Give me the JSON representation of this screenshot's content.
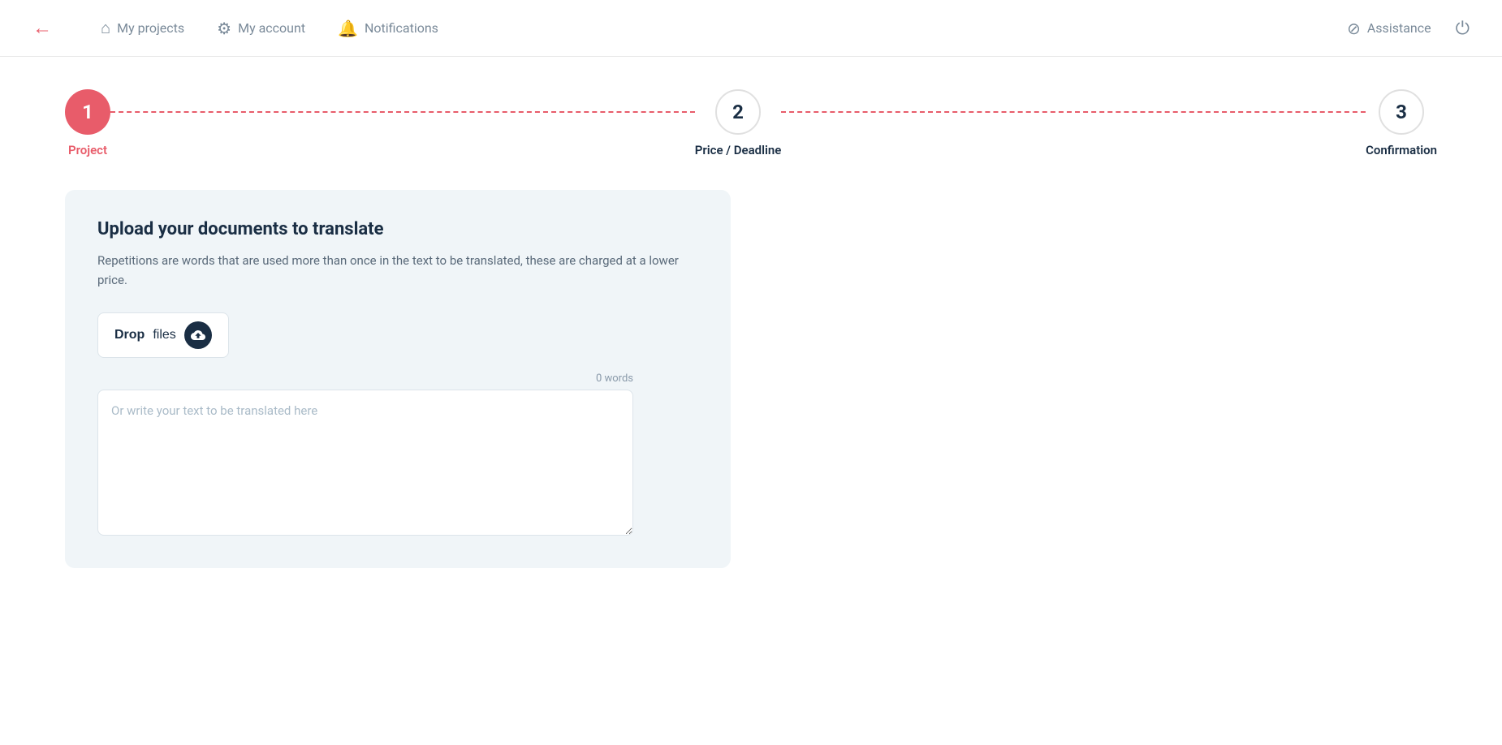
{
  "header": {
    "back_label": "←",
    "nav": {
      "projects_label": "My projects",
      "account_label": "My account",
      "notifications_label": "Notifications",
      "assistance_label": "Assistance"
    }
  },
  "stepper": {
    "step1": {
      "number": "1",
      "label": "Project",
      "state": "active"
    },
    "step2": {
      "number": "2",
      "label": "Price / Deadline",
      "state": "inactive"
    },
    "step3": {
      "number": "3",
      "label": "Confirmation",
      "state": "inactive"
    }
  },
  "card": {
    "title": "Upload your documents to translate",
    "description": "Repetitions are words that are used more than once in the text to be translated, these are charged at a lower price.",
    "drop_label_bold": "Drop",
    "drop_label_rest": " files",
    "word_count": "0 words",
    "textarea_placeholder": "Or write your text to be translated here"
  }
}
